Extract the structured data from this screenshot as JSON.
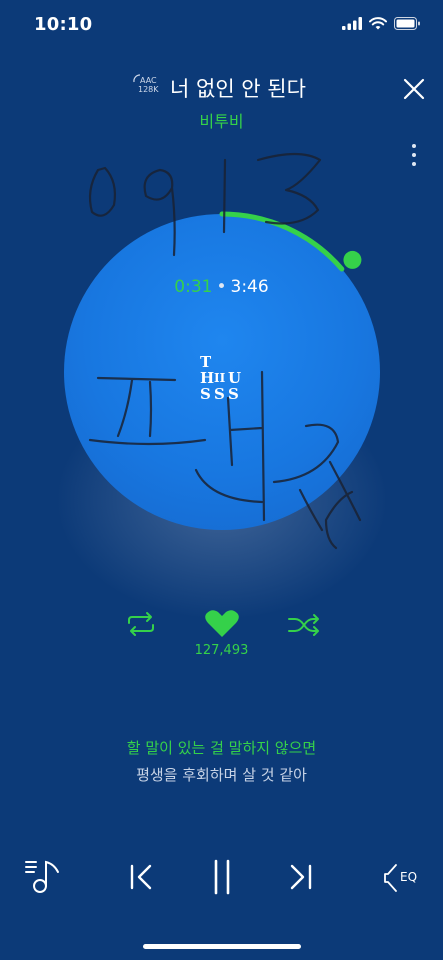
{
  "status_bar": {
    "time": "10:10",
    "icons": [
      "signal-icon",
      "wifi-icon",
      "battery-icon"
    ]
  },
  "header": {
    "quality_badge": {
      "codec": "AAC",
      "bitrate": "128K"
    },
    "title": "너 없인 안 된다",
    "artist": "비투비"
  },
  "player": {
    "elapsed": "0:31",
    "separator": "•",
    "duration": "3:46",
    "progress_fraction": 0.137,
    "album_logo": [
      "T",
      "H",
      "II",
      "U",
      "S",
      "S",
      "S"
    ]
  },
  "controls": {
    "like_count": "127,493"
  },
  "lyrics": {
    "current": "할 말이 있는 걸 말하지 않으면",
    "next": "평생을 후회하며 살 것 같아"
  },
  "bottom_bar": {
    "eq_label": "EQ"
  },
  "colors": {
    "background": "#0c3a78",
    "disc": "#1877e0",
    "accent": "#35d14a",
    "text": "#ffffff"
  }
}
